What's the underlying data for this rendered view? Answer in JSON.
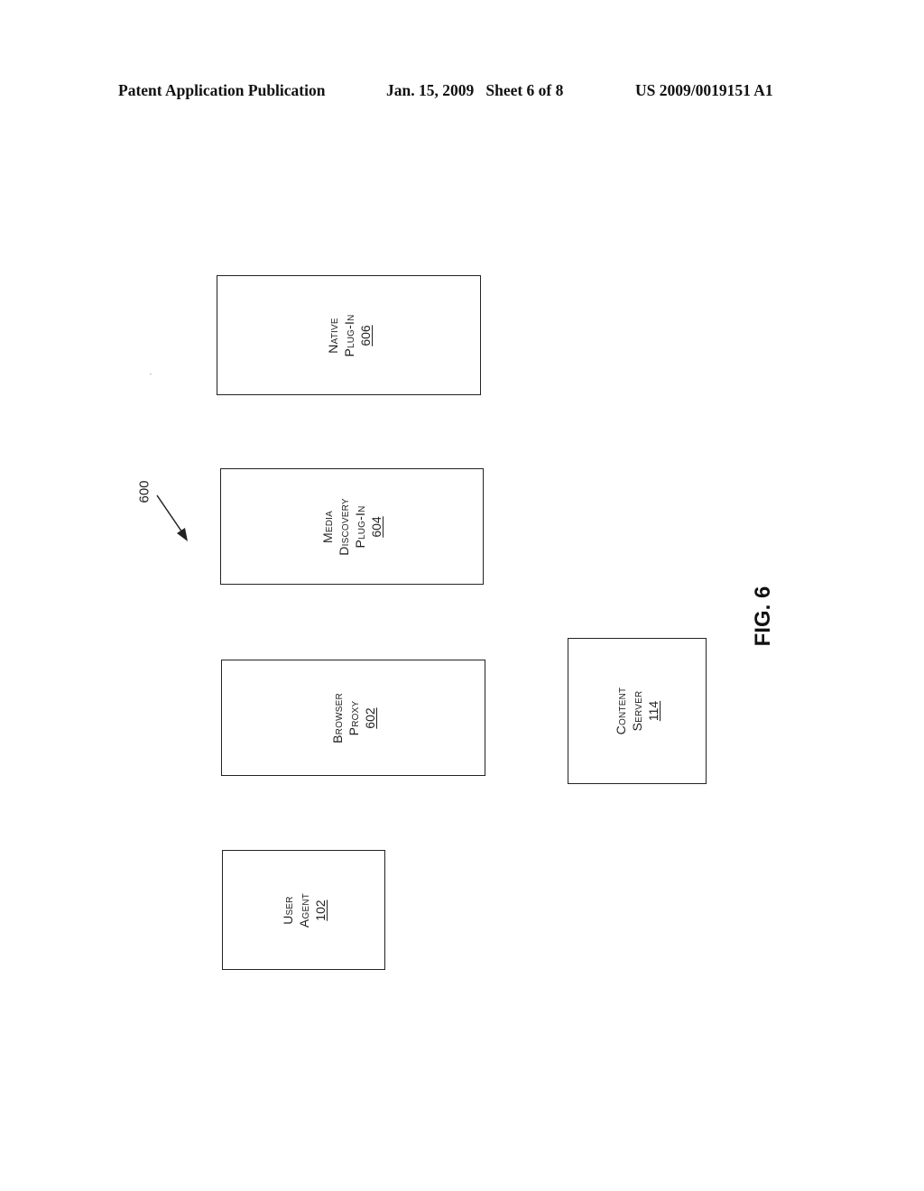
{
  "header": {
    "publication": "Patent Application Publication",
    "date_sheet": "Jan. 15, 2009   Sheet 6 of 8",
    "patent_number": "US 2009/0019151 A1"
  },
  "diagram": {
    "figure_ref": "600",
    "figure_label": "FIG. 6",
    "boxes": [
      {
        "id": "native-plug-in",
        "lines": [
          "Native",
          "Plug-In"
        ],
        "ref": "606"
      },
      {
        "id": "media-discovery-plug-in",
        "lines": [
          "Media",
          "Discovery",
          "Plug-In"
        ],
        "ref": "604"
      },
      {
        "id": "browser-proxy",
        "lines": [
          "Browser",
          "Proxy"
        ],
        "ref": "602"
      },
      {
        "id": "content-server",
        "lines": [
          "Content",
          "Server"
        ],
        "ref": "114"
      },
      {
        "id": "user-agent",
        "lines": [
          "User",
          "Agent"
        ],
        "ref": "102"
      }
    ]
  }
}
